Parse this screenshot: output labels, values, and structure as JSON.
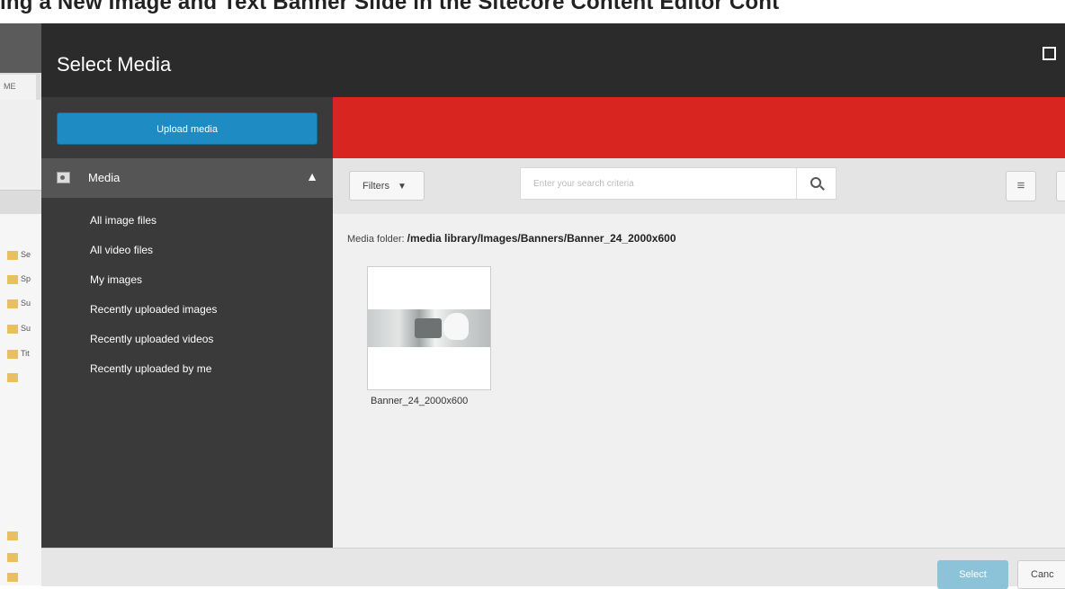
{
  "doc_header_text": "ing a New Image and Text Banner Slide in the Sitecore Content Editor Cont",
  "background_app": {
    "tab_label": "ME",
    "tree_rows": [
      "Se",
      "Sp",
      "Su",
      "Su",
      "Tit"
    ]
  },
  "dialog": {
    "title": "Select Media",
    "upload_button": "Upload media",
    "sidebar": {
      "section_label": "Media",
      "items": [
        "All image files",
        "All video files",
        "My images",
        "Recently uploaded images",
        "Recently uploaded videos",
        "Recently uploaded by me"
      ]
    },
    "toolbar": {
      "filters_label": "Filters",
      "search_placeholder": "Enter your search criteria"
    },
    "content": {
      "folder_label": "Media folder:",
      "folder_path": "/media library/Images/Banners/Banner_24_2000x600",
      "items": [
        {
          "name": "Banner_24_2000x600"
        }
      ]
    },
    "footer": {
      "select_label": "Select",
      "cancel_label": "Canc"
    }
  },
  "colors": {
    "accent_red": "#d8251f",
    "upload_blue": "#1e8bc3",
    "header_dark": "#2b2b2b",
    "sidebar_dark": "#3a3a3a"
  }
}
